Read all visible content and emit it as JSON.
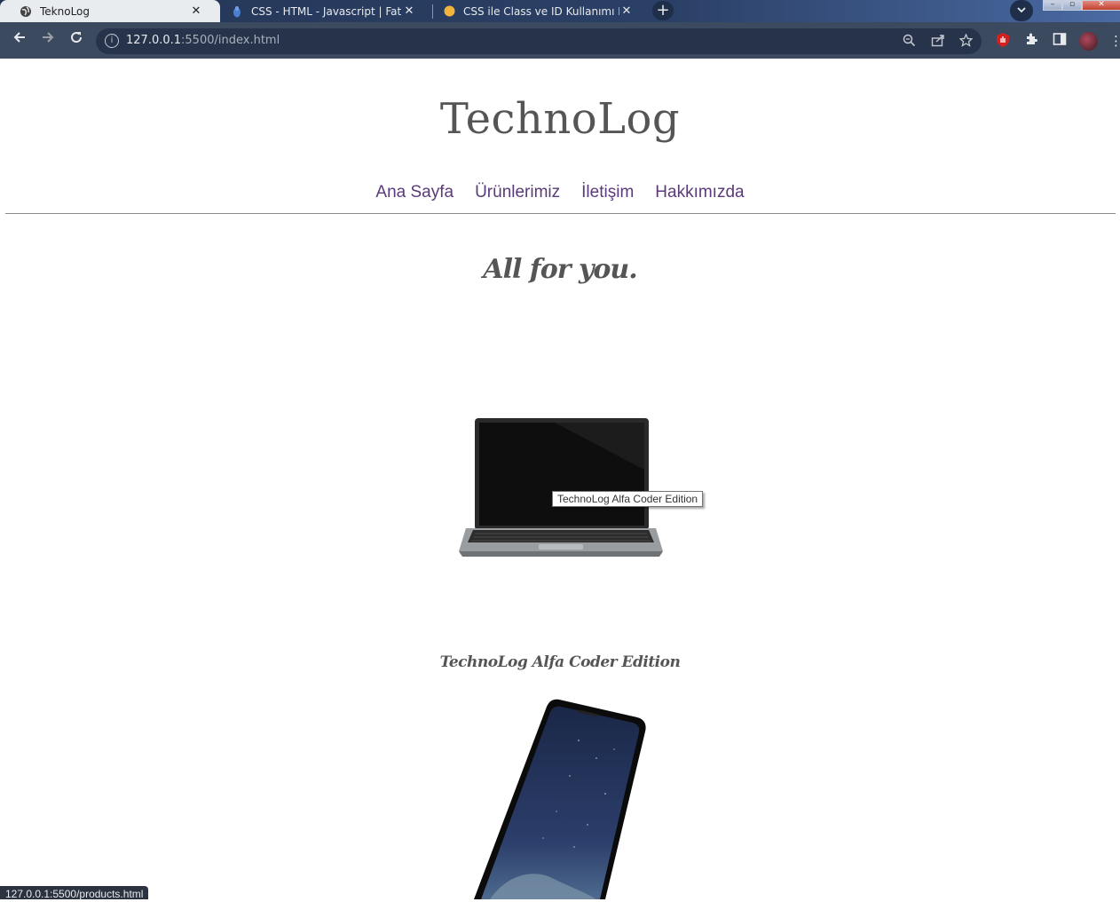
{
  "browser": {
    "tabs": [
      {
        "title": "TeknoLog",
        "favicon": "globe-icon",
        "active": true
      },
      {
        "title": "CSS - HTML - Javascript | Fatih Hayrioğlu",
        "favicon": "hand-icon",
        "active": false
      },
      {
        "title": "CSS ile Class ve ID Kullanımı Dersi",
        "favicon": "circle-icon",
        "active": false
      }
    ],
    "close_glyph": "✕",
    "new_tab_glyph": "+",
    "url_host": "127.0.0.1",
    "url_rest": ":5500/index.html",
    "status_url": "127.0.0.1:5500/products.html"
  },
  "site": {
    "title": "TechnoLog",
    "nav": [
      "Ana Sayfa",
      "Ürünlerimiz",
      "İletişim",
      "Hakkımızda"
    ],
    "tagline": "All for you.",
    "tooltip": "TechnoLog Alfa Coder Edition",
    "product_caption": "TechnoLog Alfa Coder Edition"
  },
  "colors": {
    "title": "#555555",
    "nav_link": "#5a3a78",
    "chrome_bg": "#3c4a5f"
  }
}
